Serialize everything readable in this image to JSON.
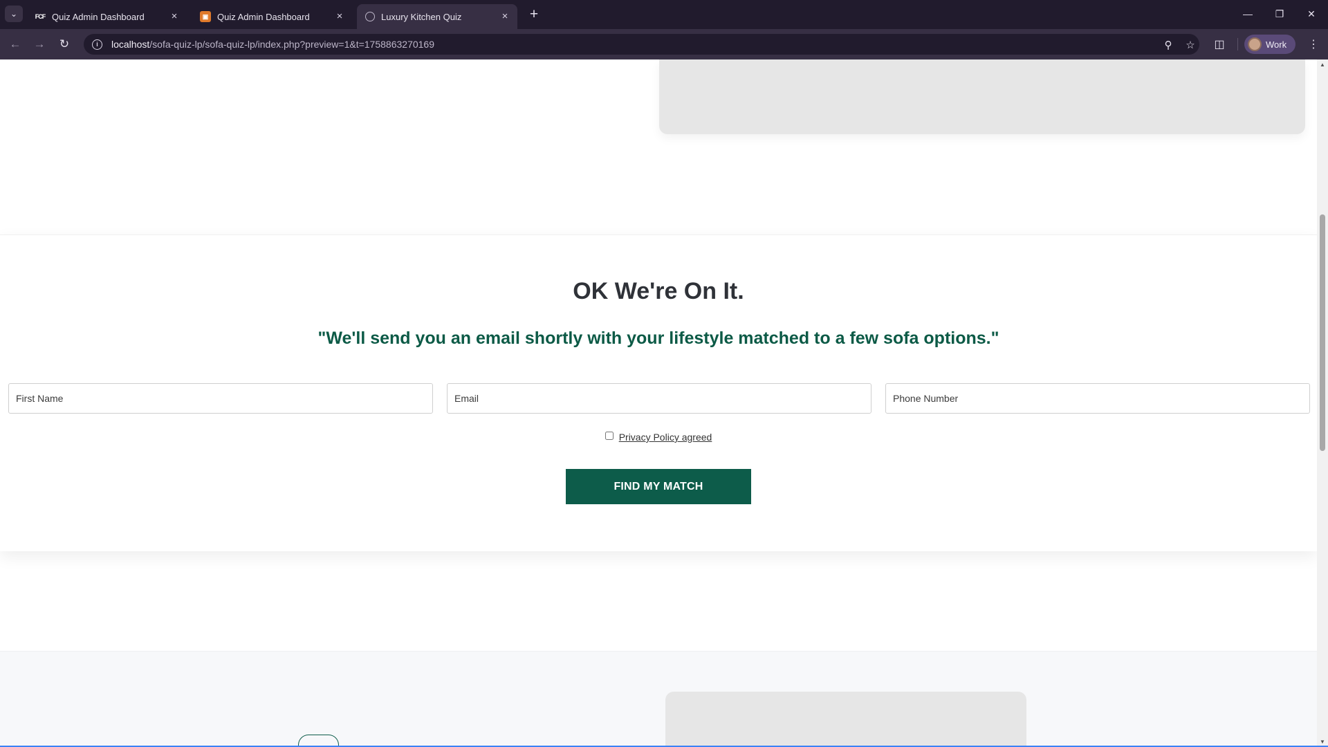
{
  "browser": {
    "tabs": [
      {
        "title": "Quiz Admin Dashboard",
        "favicon": "fcf-logo-icon",
        "active": false
      },
      {
        "title": "Quiz Admin Dashboard",
        "favicon": "orange-app-icon",
        "active": false
      },
      {
        "title": "Luxury Kitchen Quiz",
        "favicon": "globe-icon",
        "active": true
      }
    ],
    "favicon_text": "FCF",
    "url_host": "localhost",
    "url_path": "/sofa-quiz-lp/sofa-quiz-lp/index.php?preview=1&t=1758863270169",
    "profile_label": "Work",
    "accent_color": "#5a4a78"
  },
  "page": {
    "headline": "OK We're On It.",
    "subline": "\"We'll send you an email shortly with your lifestyle matched to a few sofa options.\"",
    "form": {
      "first_name_placeholder": "First Name",
      "email_placeholder": "Email",
      "phone_placeholder": "Phone Number",
      "privacy_label": "Privacy Policy agreed",
      "privacy_checked": false,
      "submit_label": "FIND MY MATCH"
    },
    "brand_color": "#0d5c4a"
  }
}
